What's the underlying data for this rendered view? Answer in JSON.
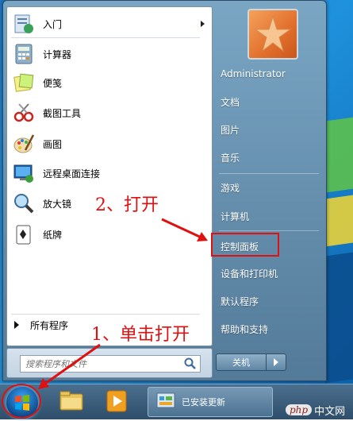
{
  "programs": [
    {
      "label": "入门",
      "icon": "getting-started-icon",
      "has_submenu": true
    },
    {
      "label": "计算器",
      "icon": "calculator-icon"
    },
    {
      "label": "便笺",
      "icon": "sticky-notes-icon"
    },
    {
      "label": "截图工具",
      "icon": "snipping-tool-icon"
    },
    {
      "label": "画图",
      "icon": "paint-icon"
    },
    {
      "label": "远程桌面连接",
      "icon": "remote-desktop-icon"
    },
    {
      "label": "放大镜",
      "icon": "magnifier-icon"
    },
    {
      "label": "纸牌",
      "icon": "solitaire-icon"
    }
  ],
  "all_programs": "所有程序",
  "search": {
    "placeholder": "搜索程序和文件"
  },
  "right_menu": {
    "user": "Administrator",
    "documents": "文档",
    "pictures": "图片",
    "music": "音乐",
    "games": "游戏",
    "computer": "计算机",
    "control_panel": "控制面板",
    "devices_printers": "设备和打印机",
    "default_programs": "默认程序",
    "help_support": "帮助和支持"
  },
  "shutdown": {
    "label": "关机"
  },
  "taskbar": {
    "window_label": "已安装更新"
  },
  "annotations": {
    "step1": "1、单击打开",
    "step2": "2、打开"
  },
  "watermark": {
    "brand": "php",
    "site": "中文网"
  },
  "colors": {
    "annotation_red": "#e01010",
    "desktop_blue": "#1f92dd"
  }
}
